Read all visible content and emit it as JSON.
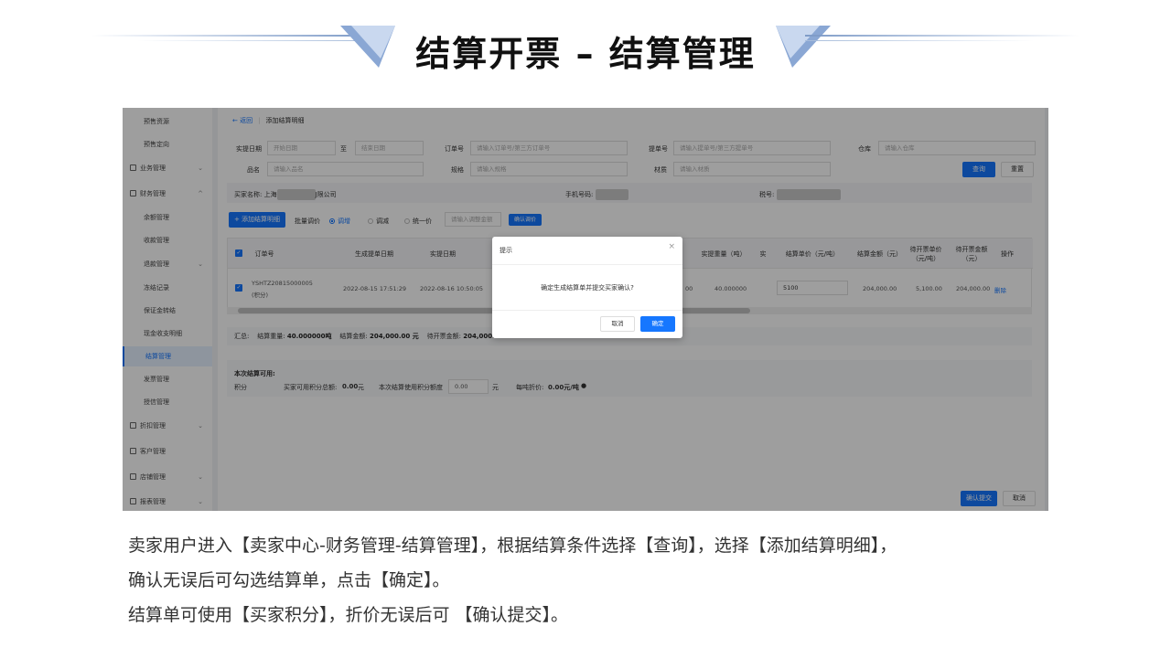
{
  "header": {
    "title": "结算开票 – 结算管理"
  },
  "sidebar": {
    "items": [
      {
        "label": "预售资源",
        "type": "sub"
      },
      {
        "label": "预售定向",
        "type": "sub"
      },
      {
        "label": "业务管理",
        "type": "top"
      },
      {
        "label": "财务管理",
        "type": "top"
      },
      {
        "label": "余额管理",
        "type": "sub"
      },
      {
        "label": "收款管理",
        "type": "sub"
      },
      {
        "label": "退款管理",
        "type": "sub"
      },
      {
        "label": "冻结记录",
        "type": "sub"
      },
      {
        "label": "保证金转结",
        "type": "sub"
      },
      {
        "label": "现金收支明细",
        "type": "sub"
      },
      {
        "label": "结算管理",
        "type": "sub"
      },
      {
        "label": "发票管理",
        "type": "sub"
      },
      {
        "label": "授信管理",
        "type": "sub"
      },
      {
        "label": "折扣管理",
        "type": "top"
      },
      {
        "label": "客户管理",
        "type": "top"
      },
      {
        "label": "店铺管理",
        "type": "top"
      },
      {
        "label": "报表管理",
        "type": "top"
      }
    ]
  },
  "breadcrumb": {
    "back": "← 返回",
    "current": "添加结算明细"
  },
  "filters": {
    "actual_date_label": "实提日期",
    "start_placeholder": "开始日期",
    "to": "至",
    "end_placeholder": "结束日期",
    "order_label": "订单号",
    "order_placeholder": "请输入订单号/第三方订单号",
    "pickup_label": "提单号",
    "pickup_placeholder": "请输入提单号/第三方提单号",
    "warehouse_label": "仓库",
    "warehouse_placeholder": "请输入仓库",
    "product_label": "品名",
    "product_placeholder": "请输入品名",
    "spec_label": "规格",
    "spec_placeholder": "请输入规格",
    "material_label": "材质",
    "material_placeholder": "请输入材质",
    "query_button": "查询",
    "reset_button": "重置"
  },
  "seller_info": {
    "buyer_label": "买家名称: 上海",
    "buyer_suffix": "J限公司",
    "phone_label": "手机号码:",
    "tax_label": "税号:"
  },
  "toolbar": {
    "add_button": "+ 添加结算明细",
    "batch_label": "批量调价",
    "options": [
      "调增",
      "调减",
      "统一价"
    ],
    "adjust_placeholder": "请输入调整金额",
    "confirm_adjust": "确认调价"
  },
  "table": {
    "headers": [
      "订单号",
      "生成提单日期",
      "实提日期",
      "实提重量（吨）",
      "实",
      "结算单价（元/吨）",
      "结算金额（元）",
      "待开票单价（元/吨）",
      "待开票金额（元）",
      "操作"
    ],
    "row": {
      "order_no": "YSHTZ20815000005",
      "order_tag": "(积分)",
      "created": "2022-08-15 17:51:29",
      "actual": "2022-08-16 10:50:05",
      "partial": "00",
      "weight": "40.000000",
      "unit_price": "5100",
      "amount": "204,000.00",
      "invoice_unit": "5,100.00",
      "invoice_amount": "204,000.00",
      "action": "删除"
    }
  },
  "summary": {
    "label": "汇总:",
    "weight_label": "结算重量:",
    "weight_value": "40.000000吨",
    "amount_label": "结算金额:",
    "amount_value": "204,000.00 元",
    "invoice_label": "待开票金额:",
    "invoice_value": "204,000.00"
  },
  "credit": {
    "title": "本次结算可用:",
    "points_label": "积分",
    "seller_points_label": "买家可用积分总额:",
    "seller_points_value": "0.00",
    "yuan": "元",
    "use_label": "本次结算使用积分额度",
    "use_value": "0.00",
    "per_ton_label": "每吨折价:",
    "per_ton_value": "0.00元/吨"
  },
  "footer_buttons": {
    "submit": "确认提交",
    "cancel": "取消"
  },
  "dialog": {
    "title": "提示",
    "close": "×",
    "message": "确定生成结算单并提交买家确认?",
    "cancel": "取消",
    "ok": "确定"
  },
  "caption": {
    "line1": "卖家用户进入【卖家中心-财务管理-结算管理】，根据结算条件选择【查询】，选择【添加结算明细】，",
    "line2": "确认无误后可勾选结算单，点击【确定】。",
    "line3": "结算单可使用【买家积分】，折价无误后可 【确认提交】。"
  }
}
